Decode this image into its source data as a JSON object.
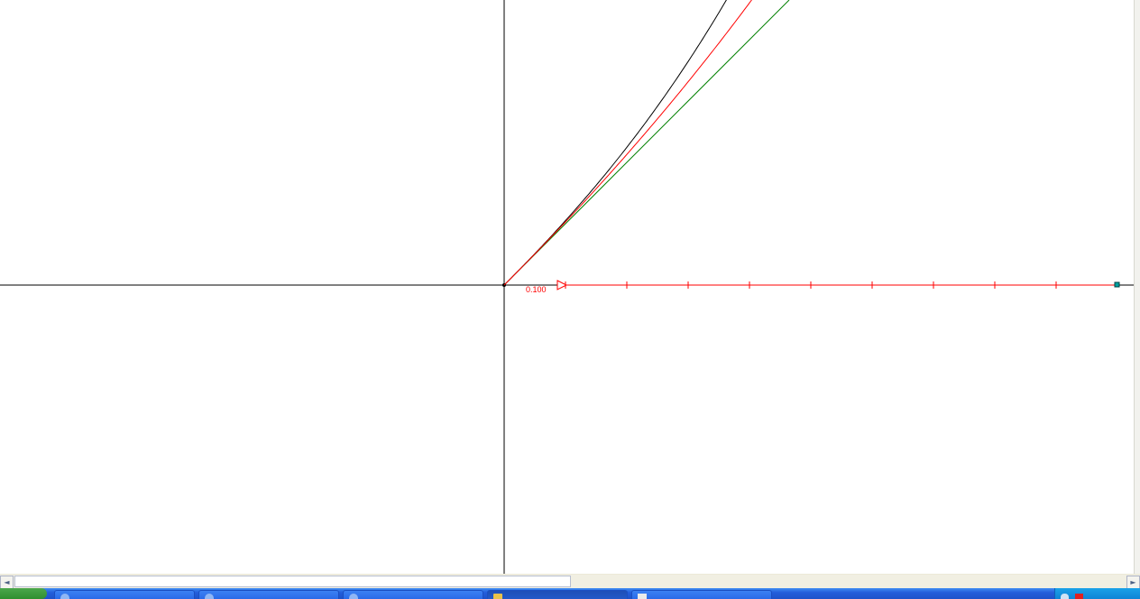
{
  "window": {
    "slider_label": "0.100"
  },
  "colors": {
    "axis": "#000000",
    "curve_black": "#000000",
    "curve_red": "#ff0000",
    "line_green": "#008000",
    "slider": "#ff0000",
    "slider_end_point": "#00a0a0"
  },
  "taskbar": {
    "buttons": [
      {
        "label": "",
        "icon": "app-icon"
      },
      {
        "label": "",
        "icon": "app-icon"
      },
      {
        "label": "",
        "icon": "app-icon"
      },
      {
        "label": "",
        "icon": "geometry-app-icon",
        "active": true
      },
      {
        "label": "",
        "icon": "document-icon"
      }
    ],
    "tray_icons": [
      "network-icon",
      "security-icon"
    ]
  },
  "scrollbar": {
    "left_arrow": "◄",
    "right_arrow": "►"
  }
}
